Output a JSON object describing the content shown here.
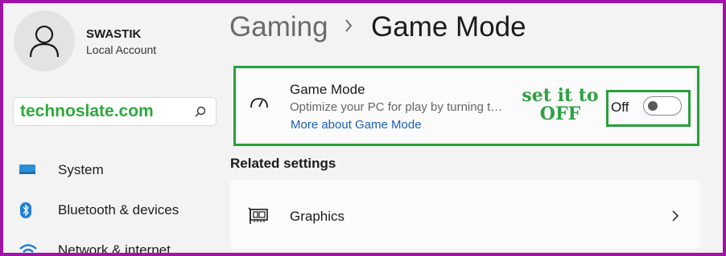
{
  "account": {
    "name": "SWASTIK",
    "type": "Local Account"
  },
  "search": {
    "value": "technoslate.com"
  },
  "nav": {
    "items": [
      {
        "label": "System",
        "icon": "monitor-icon"
      },
      {
        "label": "Bluetooth & devices",
        "icon": "bluetooth-icon"
      },
      {
        "label": "Network & internet",
        "icon": "wifi-icon"
      }
    ]
  },
  "breadcrumb": {
    "parent": "Gaming",
    "separator": ">",
    "current": "Game Mode"
  },
  "game_mode": {
    "title": "Game Mode",
    "description": "Optimize your PC for play by turning things off in the background",
    "link": "More about Game Mode",
    "toggle_state": "Off",
    "annotation": "set it to OFF"
  },
  "related": {
    "heading": "Related settings",
    "items": [
      {
        "label": "Graphics"
      }
    ]
  },
  "colors": {
    "border": "#a012a8",
    "highlight": "#27a03a",
    "annotation": "#2ea043",
    "link": "#1a5fb4"
  }
}
